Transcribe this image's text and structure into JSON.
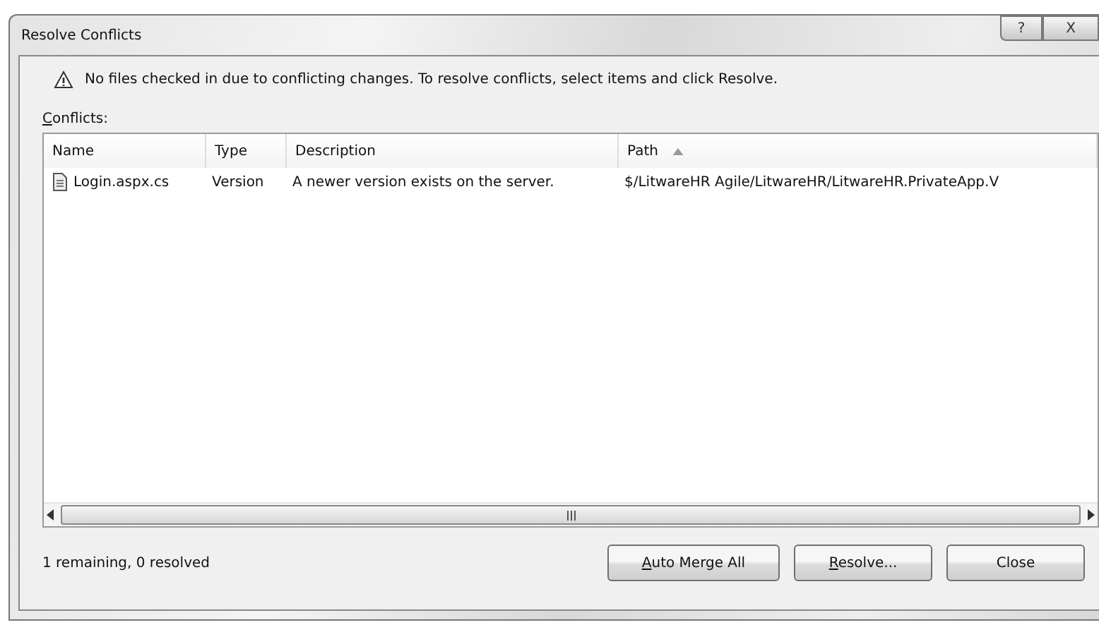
{
  "window": {
    "title": "Resolve Conflicts",
    "help_button": "?",
    "close_button": "X"
  },
  "message": "No files checked in due to conflicting changes. To resolve conflicts, select items and click Resolve.",
  "list_label": {
    "text": "Conflicts:",
    "mnemonic": true
  },
  "table": {
    "columns": [
      {
        "label": "Name",
        "sorted_ascending": false
      },
      {
        "label": "Type",
        "sorted_ascending": false
      },
      {
        "label": "Description",
        "sorted_ascending": false
      },
      {
        "label": "Path",
        "sorted_ascending": true
      }
    ],
    "rows": [
      {
        "selected": false,
        "cells": [
          "Login.aspx.cs",
          "Version",
          "A newer version exists on the server.",
          "$/LitwareHR Agile/LitwareHR/LitwareHR.PrivateApp.V"
        ]
      }
    ]
  },
  "status": "1 remaining, 0 resolved",
  "buttons": [
    {
      "label": "Auto Merge All",
      "mnemonic": true
    },
    {
      "label": "Resolve...",
      "mnemonic": true
    },
    {
      "label": "Close",
      "mnemonic": false
    }
  ]
}
